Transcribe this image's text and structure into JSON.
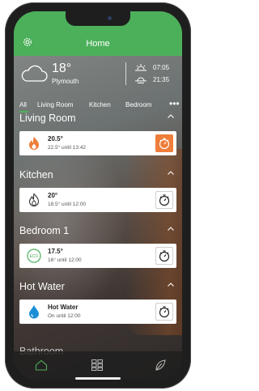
{
  "header": {
    "title": "Home"
  },
  "weather": {
    "temperature": "18°",
    "location": "Plymouth",
    "sunrise": "07:05",
    "sunset": "21:35"
  },
  "tabs": [
    {
      "label": "All"
    },
    {
      "label": "Living Room"
    },
    {
      "label": "Kitchen"
    },
    {
      "label": "Bedroom"
    }
  ],
  "more_label": "•••",
  "sections": [
    {
      "title": "Living Room",
      "main": "20.5°",
      "sub": "22.5° until 13:42",
      "icon": "flame-icon",
      "timer_active": true
    },
    {
      "title": "Kitchen",
      "main": "20°",
      "sub": "18.5° until 12:00",
      "icon": "flame-outline-icon",
      "timer_active": false
    },
    {
      "title": "Bedroom 1",
      "main": "17.5°",
      "sub": "16° until 12:00",
      "icon": "eco-icon",
      "eco_label": "ECO",
      "timer_active": false
    },
    {
      "title": "Hot Water",
      "main": "Hot Water",
      "sub": "On until 12:00",
      "icon": "water-drop-icon",
      "timer_active": false
    }
  ],
  "partial_section": {
    "title": "Bathroom"
  },
  "bottom_nav": [
    {
      "icon": "home-icon"
    },
    {
      "icon": "grid-icon"
    },
    {
      "icon": "leaf-icon"
    }
  ],
  "colors": {
    "accent": "#4cb05b",
    "timer_active": "#ee7e3a",
    "flame": "#ee7e3a",
    "drop": "#1a8fd6"
  }
}
